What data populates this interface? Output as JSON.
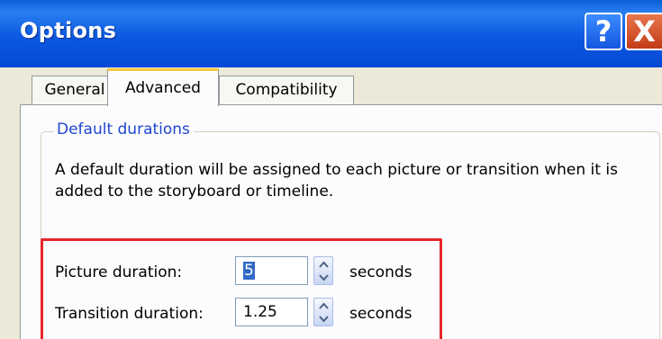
{
  "window": {
    "title": "Options",
    "help_button": "?",
    "close_button": "X"
  },
  "tabs": [
    {
      "label": "General",
      "selected": false
    },
    {
      "label": "Advanced",
      "selected": true
    },
    {
      "label": "Compatibility",
      "selected": false
    }
  ],
  "default_durations": {
    "group_title": "Default durations",
    "description": "A default duration will be assigned to each picture or transition when it is added to the storyboard or timeline.",
    "picture_duration": {
      "label": "Picture duration:",
      "value": "5",
      "unit": "seconds"
    },
    "transition_duration": {
      "label": "Transition duration:",
      "value": "1.25",
      "unit": "seconds"
    }
  },
  "colors": {
    "title_bar": "#0a5fd8",
    "highlight_box": "#e8262c",
    "group_title_text": "#1e46d0",
    "selected_tab_accent": "#ffc83c"
  }
}
